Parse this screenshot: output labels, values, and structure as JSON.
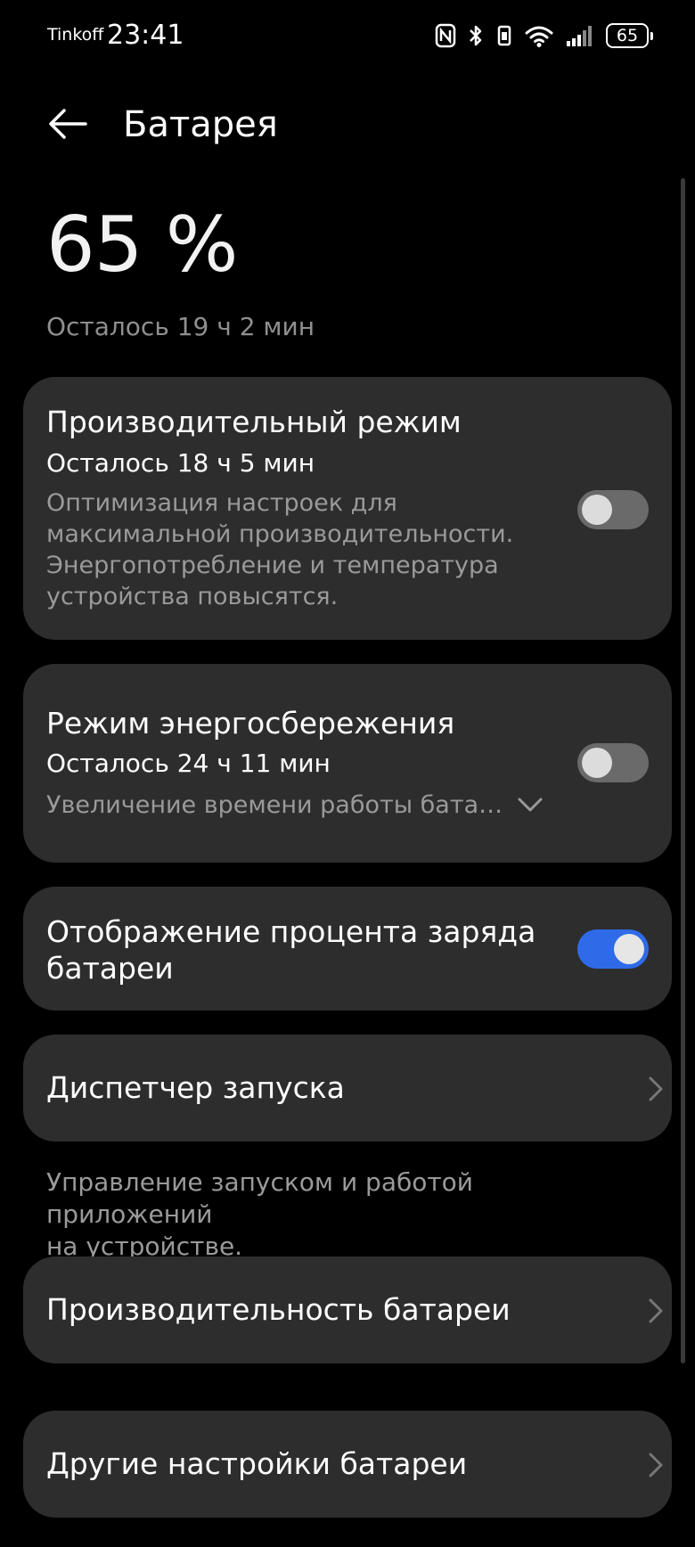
{
  "status_bar": {
    "carrier": "Tinkoff",
    "time": "23:41",
    "battery_level": "65",
    "icons": [
      "nfc-icon",
      "bluetooth-icon",
      "vibrate-icon",
      "wifi-icon",
      "signal-icon",
      "battery-icon"
    ]
  },
  "header": {
    "title": "Батарея",
    "back_icon": "arrow-left-icon"
  },
  "battery": {
    "percent": "65 %",
    "remaining": "Осталось 19 ч 2 мин"
  },
  "performance_mode": {
    "title": "Производительный режим",
    "remaining": "Осталось 18 ч 5 мин",
    "desc_line1": "Оптимизация настроек для",
    "desc_line2": "максимальной производительности.",
    "desc_line3": "Энергопотребление и температура",
    "desc_line4": "устройства повысятся.",
    "enabled": false
  },
  "power_saving": {
    "title": "Режим энергосбережения",
    "remaining": "Осталось 24 ч 11 мин",
    "desc": "Увеличение времени работы бата…",
    "enabled": false
  },
  "percent_display": {
    "title_line1": "Отображение процента заряда",
    "title_line2": "батареи",
    "enabled": true
  },
  "launch_manager": {
    "title": "Диспетчер запуска",
    "footnote_line1": "Управление запуском и работой приложений",
    "footnote_line2": "на устройстве."
  },
  "battery_performance": {
    "title": "Производительность батареи"
  },
  "other_settings": {
    "title": "Другие настройки батареи"
  },
  "colors": {
    "background": "#000000",
    "card": "#2d2d2d",
    "toggle_on": "#2f6be8",
    "toggle_off": "#6a6a6a",
    "secondary_text": "#9a9a9a"
  }
}
